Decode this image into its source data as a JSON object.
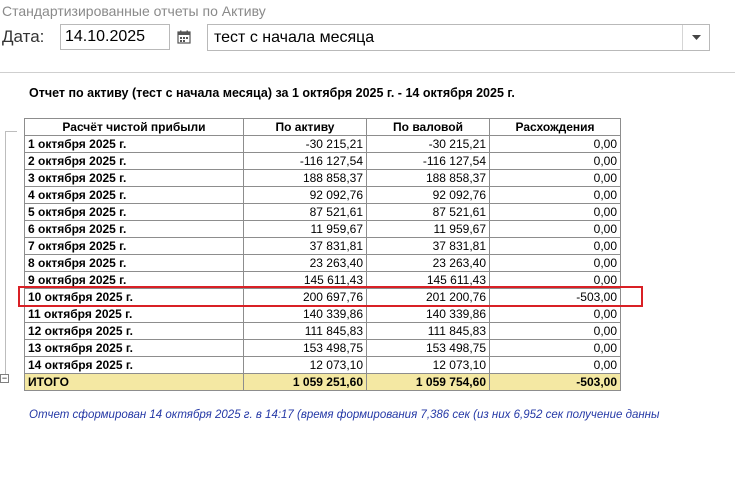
{
  "window": {
    "title": "Стандартизированные отчеты по Активу"
  },
  "params": {
    "date_label": "Дата:",
    "date_value": "14.10.2025",
    "period_value": "тест с начала месяца"
  },
  "report": {
    "title": "Отчет по активу (тест с начала месяца) за 1 октября 2025 г. - 14 октября 2025 г.",
    "columns": [
      "Расчёт чистой прибыли",
      "По активу",
      "По валовой",
      "Расхождения"
    ],
    "rows": [
      [
        "1 октября 2025 г.",
        "-30 215,21",
        "-30 215,21",
        "0,00"
      ],
      [
        "2 октября 2025 г.",
        "-116 127,54",
        "-116 127,54",
        "0,00"
      ],
      [
        "3 октября 2025 г.",
        "188 858,37",
        "188 858,37",
        "0,00"
      ],
      [
        "4 октября 2025 г.",
        "92 092,76",
        "92 092,76",
        "0,00"
      ],
      [
        "5 октября 2025 г.",
        "87 521,61",
        "87 521,61",
        "0,00"
      ],
      [
        "6 октября 2025 г.",
        "11 959,67",
        "11 959,67",
        "0,00"
      ],
      [
        "7 октября 2025 г.",
        "37 831,81",
        "37 831,81",
        "0,00"
      ],
      [
        "8 октября 2025 г.",
        "23 263,40",
        "23 263,40",
        "0,00"
      ],
      [
        "9 октября 2025 г.",
        "145 611,43",
        "145 611,43",
        "0,00"
      ],
      [
        "10 октября 2025 г.",
        "200 697,76",
        "201 200,76",
        "-503,00"
      ],
      [
        "11 октября 2025 г.",
        "140 339,86",
        "140 339,86",
        "0,00"
      ],
      [
        "12 октября 2025 г.",
        "111 845,83",
        "111 845,83",
        "0,00"
      ],
      [
        "13 октября 2025 г.",
        "153 498,75",
        "153 498,75",
        "0,00"
      ],
      [
        "14 октября 2025 г.",
        "12 073,10",
        "12 073,10",
        "0,00"
      ]
    ],
    "total": [
      "ИТОГО",
      "1 059 251,60",
      "1 059 754,60",
      "-503,00"
    ],
    "footer": "Отчет сформирован 14 октября 2025 г. в 14:17 (время формирования 7,386 сек (из них 6,952 сек получение данны"
  },
  "colors": {
    "highlight": "#d92025",
    "total_row": "#f4e8a3",
    "footer_text": "#2539a6"
  },
  "icons": {
    "date_picker": "calendar-icon",
    "dropdown": "chevron-down-icon"
  }
}
